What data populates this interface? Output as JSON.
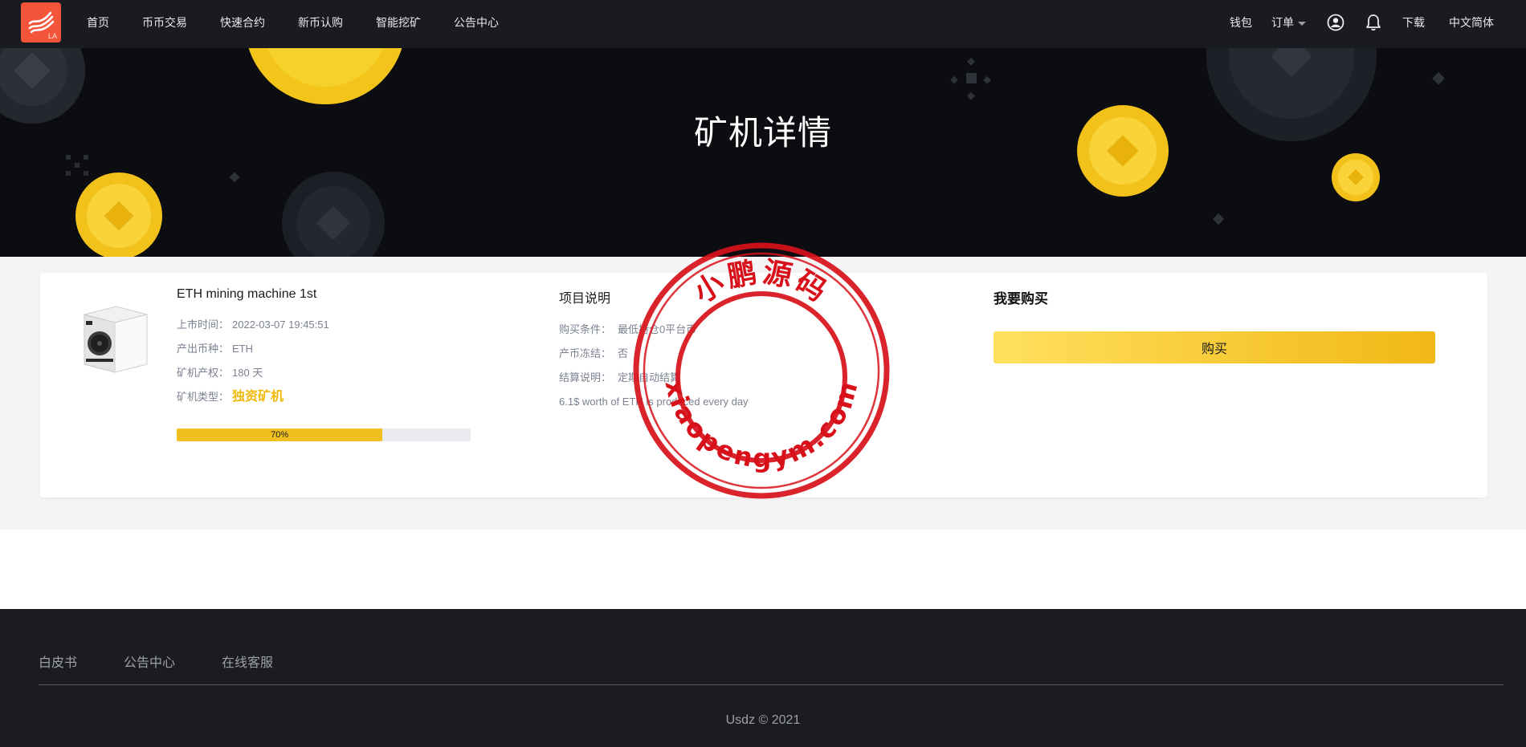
{
  "nav": {
    "logo_text": "LA",
    "items": [
      "首页",
      "币币交易",
      "快速合约",
      "新币认购",
      "智能挖矿",
      "公告中心"
    ],
    "wallet": "钱包",
    "orders": "订单",
    "download": "下载",
    "language": "中文简体"
  },
  "hero": {
    "title": "矿机详情"
  },
  "product": {
    "name": "ETH mining machine 1st",
    "listed_label": "上市时间：",
    "listed_value": "2022-03-07 19:45:51",
    "coin_label": "产出币种：",
    "coin_value": "ETH",
    "term_label": "矿机产权：",
    "term_value": "180 天",
    "type_label": "矿机类型：",
    "type_value": "独资矿机",
    "progress_percent": 70,
    "progress_label": "70%"
  },
  "project": {
    "title": "项目说明",
    "condition_label": "购买条件：",
    "condition_value": "最低持仓0平台币",
    "freeze_label": "产币冻结：",
    "freeze_value": "否",
    "settle_label": "结算说明：",
    "settle_value": "定期自动结算",
    "description": "6.1$ worth of ETH is produced every day"
  },
  "buy": {
    "title": "我要购买",
    "button": "购买"
  },
  "watermark": {
    "top_text": "小鹏源码",
    "bottom_text": "xiaopengym.com"
  },
  "footer": {
    "links": [
      "白皮书",
      "公告中心",
      "在线客服"
    ],
    "copyright": "Usdz © 2021"
  },
  "colors": {
    "nav_bg": "#1a1b20",
    "hero_bg": "#0b0d11",
    "accent_gold": "#f0b90b",
    "logo_bg": "#f4553a",
    "stamp_red": "#d8101a"
  }
}
